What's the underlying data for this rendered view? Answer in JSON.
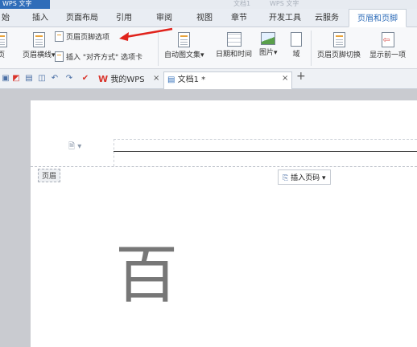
{
  "title_bar": {
    "app_fragment": "WPS 文字",
    "faint_1": "文档1",
    "faint_2": "WPS 文字"
  },
  "tabs": [
    "始",
    "插入",
    "页面布局",
    "引用",
    "审阅",
    "视图",
    "章节",
    "开发工具",
    "云服务",
    "页眉和页脚"
  ],
  "active_tab": "页眉和页脚",
  "ribbon": {
    "header_footer_options": "页眉页脚选项",
    "header_rule": "页眉横线",
    "header_rule_arrow": "▾",
    "insert_align_tab": "插入 \"对齐方式\" 选项卡",
    "left_fragment": "页",
    "auto_text": "自动图文集",
    "date_time": "日期和时间",
    "picture": "图片",
    "field": "域",
    "switch_header_footer": "页眉页脚切换",
    "show_previous": "显示前一项"
  },
  "quickbar": {
    "my_wps_tab": "我的WPS",
    "doc_tab": "文档1 *",
    "close_glyph": "×",
    "new_tab_glyph": "+"
  },
  "document": {
    "header_tag": "页眉",
    "insert_page_number": "插入页码",
    "dropdown_glyph": "▾",
    "page_icon_glyph": "🗎 ▾",
    "body_char": "百"
  },
  "colors": {
    "accent": "#2f6db9",
    "annotation_red": "#e0231c",
    "wps_red": "#d9342b"
  }
}
